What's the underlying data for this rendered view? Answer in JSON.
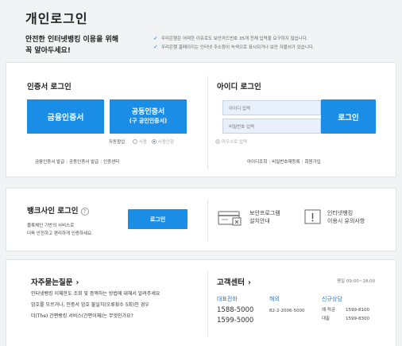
{
  "page": {
    "title": "개인로그인",
    "intro_line1": "안전한 인터넷뱅킹 이용을 위해",
    "intro_line2": "꼭 알아두세요!",
    "notices": [
      "우리은행은 어떠한 이유로도 보안카드번호 35개 전체 입력을 요구하지 않습니다.",
      "우리은행 홈페이지는 인터넷 주소창이 녹색으로 표시되거나 보안 자물쇠가 있습니다."
    ]
  },
  "cert_login": {
    "heading": "인증서 로그인",
    "finance_cert_button": "금융인증서",
    "joint_cert_line1": "공동인증서",
    "joint_cert_line2": "(구 공인인증서)",
    "auto_popup_label": "자동팝업",
    "radio_use": "사용",
    "radio_nouse": "사용안함",
    "links": [
      "금융인증서 발급",
      "공동인증서 발급",
      "인증센터"
    ]
  },
  "id_login": {
    "heading": "아이디 로그인",
    "id_placeholder": "아이디 입력",
    "pw_placeholder": "비밀번호 입력",
    "login_button": "로그인",
    "mouse_input": "마우스로 입력",
    "links": [
      "아이디조회",
      "비밀번호재등록",
      "회원가입"
    ]
  },
  "banksign": {
    "heading": "뱅크사인 로그인",
    "desc_line1": "블록체인 기반의 서비스로",
    "desc_line2": "더욱 안전하고 편리하게 인증하세요.",
    "login_button": "로그인",
    "security_line1": "보안프로그램",
    "security_line2": "설치안내",
    "caution_line1": "인터넷뱅킹",
    "caution_line2": "이용시 유의사항"
  },
  "faq": {
    "heading": "자주묻는질문",
    "lines": [
      "인터넷뱅킹 이체한도 조회 및 증액하는 방법에 대해서 알려주세요",
      "암호를 모르거나, 인증서 암호 불일치(오류횟수 5회)인 경우",
      "더(The) 간편뱅킹 서비스(간편이체)는 무엇인가요?"
    ]
  },
  "customer_center": {
    "heading": "고객센터",
    "hours": "평일 09:00~18:00",
    "rep_label": "대표전화",
    "rep_numbers": [
      "1588-5000",
      "1599-5000"
    ],
    "overseas_label": "해외",
    "overseas_number": "82-2-2006-5000",
    "new_label": "신규상담",
    "new_rows": [
      {
        "label": "예·적금",
        "number": "1599-8100"
      },
      {
        "label": "대출",
        "number": "1599-8300"
      }
    ]
  },
  "colors": {
    "accent": "#1a8ee6",
    "link_blue": "#2a78c8"
  }
}
